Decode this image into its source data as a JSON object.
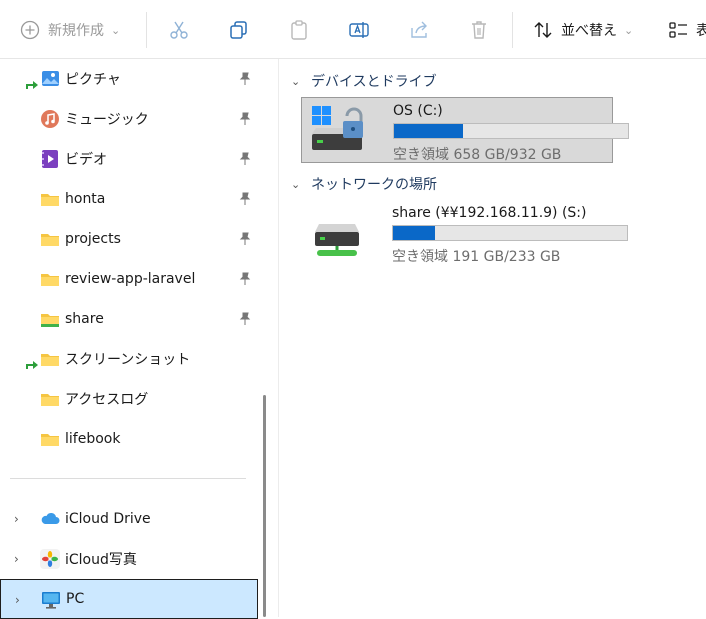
{
  "toolbar": {
    "new_label": "新規作成",
    "sort_label": "並べ替え",
    "view_label": "表"
  },
  "sidebar": {
    "quick_access": [
      {
        "label": "ピクチャ",
        "pinned": true,
        "icon": "pictures-icon"
      },
      {
        "label": "ミュージック",
        "pinned": true,
        "icon": "music-icon"
      },
      {
        "label": "ビデオ",
        "pinned": true,
        "icon": "video-icon"
      },
      {
        "label": "honta",
        "pinned": true,
        "icon": "folder-icon"
      },
      {
        "label": "projects",
        "pinned": true,
        "icon": "folder-icon"
      },
      {
        "label": "review-app-laravel",
        "pinned": true,
        "icon": "folder-icon"
      },
      {
        "label": "share",
        "pinned": true,
        "icon": "folder-icon"
      },
      {
        "label": "スクリーンショット",
        "pinned": false,
        "icon": "screenshots-folder-icon"
      },
      {
        "label": "アクセスログ",
        "pinned": false,
        "icon": "folder-icon"
      },
      {
        "label": "lifebook",
        "pinned": false,
        "icon": "folder-icon"
      }
    ],
    "locations": [
      {
        "label": "iCloud Drive",
        "icon": "icloud-drive-icon"
      },
      {
        "label": "iCloud写真",
        "icon": "icloud-photos-icon"
      },
      {
        "label": "PC",
        "icon": "pc-icon",
        "selected": true
      }
    ]
  },
  "main": {
    "groups": [
      {
        "header": "デバイスとドライブ",
        "drives": [
          {
            "name": "OS (C:)",
            "free_text": "空き領域 658 GB/932 GB",
            "used_fraction": 0.294,
            "selected": true
          }
        ]
      },
      {
        "header": "ネットワークの場所",
        "drives": [
          {
            "name": "share (¥¥192.168.11.9) (S:)",
            "free_text": "空き領域 191 GB/233 GB",
            "used_fraction": 0.18,
            "selected": false
          }
        ]
      }
    ]
  },
  "colors": {
    "accent": "#0a68c8",
    "selection": "#cce8ff",
    "folder": "#f5c542"
  }
}
